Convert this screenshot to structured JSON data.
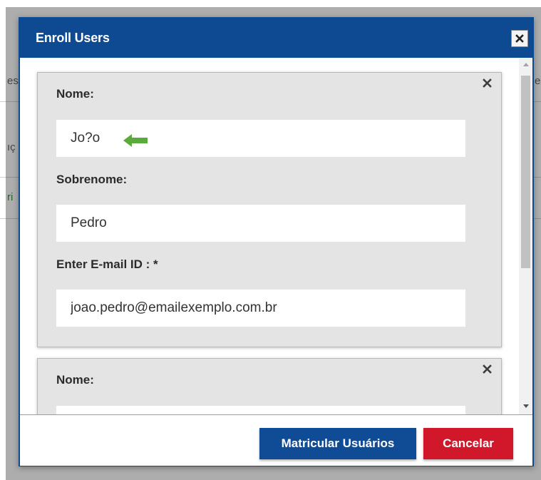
{
  "modal": {
    "title": "Enroll Users",
    "close_icon": "close-icon"
  },
  "background_fragments": [
    "es",
    "ıç",
    "ri",
    "e"
  ],
  "users": [
    {
      "first_name_label": "Nome:",
      "first_name_value": "Jo?o",
      "last_name_label": "Sobrenome:",
      "last_name_value": "Pedro",
      "email_label": "Enter E-mail ID : *",
      "email_value": "joao.pedro@emailexemplo.com.br"
    },
    {
      "first_name_label": "Nome:",
      "first_name_value": ""
    }
  ],
  "annotation": {
    "arrow_icon": "green-arrow-left-icon",
    "color": "#5aaa3c"
  },
  "footer": {
    "enroll_label": "Matricular Usuários",
    "cancel_label": "Cancelar"
  },
  "colors": {
    "header": "#0d4a92",
    "primary_button": "#104c96",
    "danger_button": "#d0182a",
    "card_bg": "#e4e4e4"
  }
}
